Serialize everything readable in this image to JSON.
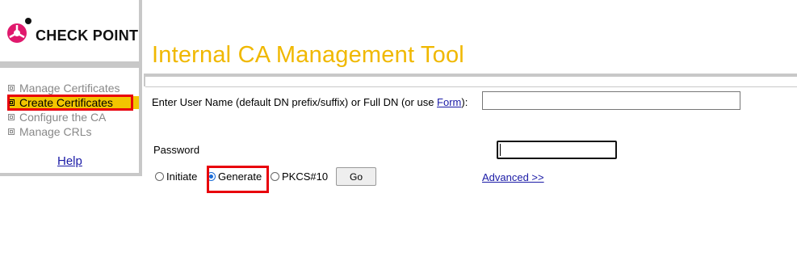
{
  "logo": {
    "text": "CHECK POINT",
    "colors": {
      "magenta": "#e0196d",
      "dark": "#111111"
    }
  },
  "nav": {
    "items": [
      {
        "label": "Manage Certificates",
        "active": false
      },
      {
        "label": "Create Certificates",
        "active": true
      },
      {
        "label": "Configure the CA",
        "active": false
      },
      {
        "label": "Manage CRLs",
        "active": false
      }
    ],
    "help_label": "Help"
  },
  "header": {
    "title": "Internal CA Management Tool"
  },
  "form": {
    "dn_label_prefix": "Enter User Name (default DN prefix/suffix) or Full DN (or use ",
    "dn_label_link": "Form",
    "dn_label_suffix": "):",
    "dn_value": "",
    "password_label": "Password",
    "password_value": "",
    "radios": [
      {
        "label": "Initiate",
        "checked": false
      },
      {
        "label": "Generate",
        "checked": true
      },
      {
        "label": "PKCS#10",
        "checked": false
      }
    ],
    "go_label": "Go",
    "advanced_label": "Advanced >>"
  },
  "theme": {
    "title_color": "#f0b800",
    "active_nav_bg": "#f2c500",
    "highlight_red": "#e8000b",
    "link_color": "#1a1aa6"
  }
}
